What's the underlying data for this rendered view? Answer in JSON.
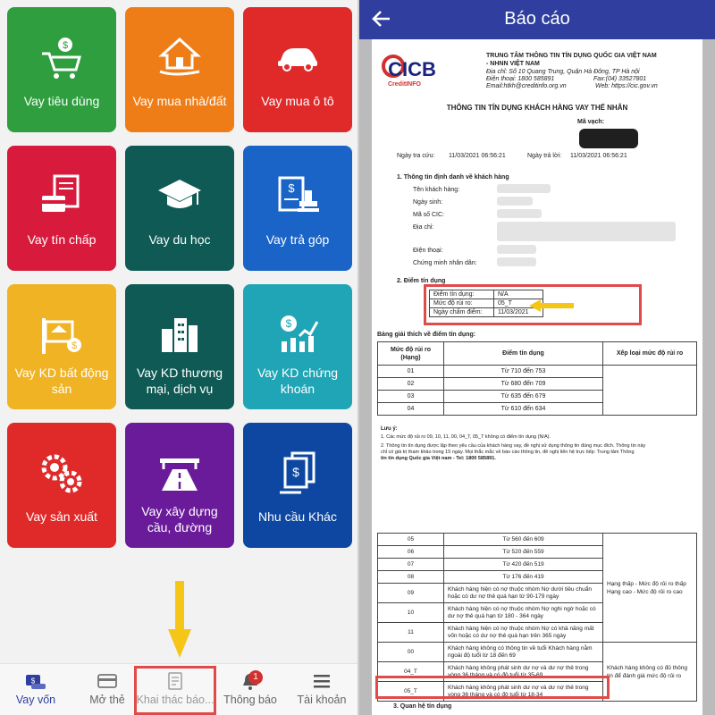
{
  "left": {
    "tiles": [
      {
        "label": "Vay tiêu dùng",
        "color": "#2e9e3e",
        "icon": "shopping-cart-icon"
      },
      {
        "label": "Vay mua nhà/đất",
        "color": "#ef7d17",
        "icon": "house-hand-icon"
      },
      {
        "label": "Vay mua ô tô",
        "color": "#e02a2a",
        "icon": "car-icon"
      },
      {
        "label": "Vay tín chấp",
        "color": "#d81b3c",
        "icon": "documents-card-icon"
      },
      {
        "label": "Vay du học",
        "color": "#0f5a55",
        "icon": "graduation-cap-icon"
      },
      {
        "label": "Vay trả góp",
        "color": "#1a63c7",
        "icon": "contract-stamp-icon"
      },
      {
        "label": "Vay KD bất động sản",
        "color": "#f0b324",
        "icon": "real-estate-sign-icon"
      },
      {
        "label": "Vay KD thương mại, dịch vụ",
        "color": "#0f5a55",
        "icon": "city-buildings-icon"
      },
      {
        "label": "Vay KD chứng khoán",
        "color": "#1fa5b5",
        "icon": "stock-chart-icon"
      },
      {
        "label": "Vay sản xuất",
        "color": "#e02a2a",
        "icon": "gears-icon"
      },
      {
        "label": "Vay xây dựng cầu, đường",
        "color": "#6a1b9a",
        "icon": "road-bridge-icon"
      },
      {
        "label": "Nhu cầu Khác",
        "color": "#0d47a1",
        "icon": "money-papers-icon"
      }
    ],
    "bottom_nav": [
      {
        "label": "Vay vốn",
        "icon": "loan-icon",
        "active": true
      },
      {
        "label": "Mở thẻ",
        "icon": "credit-card-icon",
        "active": false
      },
      {
        "label": "Khai thác báo...",
        "icon": "report-icon",
        "active": false
      },
      {
        "label": "Thông báo",
        "icon": "bell-icon",
        "active": false
      },
      {
        "label": "Tài khoản",
        "icon": "menu-icon",
        "active": false
      }
    ],
    "notification_badge": "1",
    "colors": {
      "active_nav": "#303f9f",
      "highlight": "#e14a4a",
      "arrow": "#f5c518"
    }
  },
  "right": {
    "title": "Báo cáo",
    "report": {
      "logo_text": "CICB",
      "logo_sub": "CreditINFO",
      "org_line1": "TRUNG TÂM THÔNG TIN TÍN DỤNG QUỐC GIA VIỆT NAM",
      "org_line2": "- NHNN VIỆT NAM",
      "address": "Địa chỉ: Số 10 Quang Trung, Quận Hà Đông, TP Hà nội",
      "phone": "Điện thoại: 1800 585891",
      "fax": "Fax:(04) 33527801",
      "email": "Email:htkh@creditinfo.org.vn",
      "web": "Web: https://cic.gov.vn",
      "main_title": "THÔNG TIN TÍN DỤNG KHÁCH HÀNG VAY THỂ NHÂN",
      "barcode_label": "Mã vạch:",
      "query_date_label": "Ngày tra cứu:",
      "query_date": "11/03/2021 06:56:21",
      "reply_date_label": "Ngày trả lời:",
      "reply_date": "11/03/2021 06:56:21",
      "section1": "1. Thông tin định danh về khách hàng",
      "fields": [
        "Tên khách hàng:",
        "Ngày sinh:",
        "Mã số CIC:",
        "Địa chỉ:",
        "Điện thoại:",
        "Chứng minh nhân dân:"
      ],
      "section2": "2. Điểm tín dụng",
      "score_rows": [
        {
          "label": "Điểm tín dụng:",
          "value": "N/A"
        },
        {
          "label": "Mức độ rủi ro:",
          "value": "05_T"
        },
        {
          "label": "Ngày chấm điểm:",
          "value": "11/03/2021"
        }
      ],
      "table_title": "Bảng giải thích về điểm tín dụng:",
      "headers": [
        "Mức độ rủi ro (Hạng)",
        "Điểm tín dụng",
        "Xếp loại mức độ rủi ro"
      ],
      "table1": [
        {
          "rank": "01",
          "score": "Từ 710 đến 753"
        },
        {
          "rank": "02",
          "score": "Từ 680 đến 709"
        },
        {
          "rank": "03",
          "score": "Từ 635 đến 679"
        },
        {
          "rank": "04",
          "score": "Từ 610 đến 634"
        }
      ],
      "notes_title": "Lưu ý:",
      "note1": "1. Các mức độ rủi ro 09, 10, 11, 00, 04_T, 05_T không có điểm tín dụng (N/A).",
      "note2a": "2. Thông tin tín dụng được lập theo yêu cầu của khách hàng vay, đề nghị sử dụng thông tin đúng mục đích. Thông tin này",
      "note2b": "chỉ có giá trị tham khảo trong 15 ngày. Mọi thắc mắc về báo cáo thông tin, đề nghị liên hệ trực tiếp: Trung tâm Thông",
      "note2c": "tin tín dụng Quốc gia Việt nam - Tel: 1800 585891.",
      "table2": [
        {
          "rank": "05",
          "score": "Từ 560 đến 609"
        },
        {
          "rank": "06",
          "score": "Từ 520 đến 559"
        },
        {
          "rank": "07",
          "score": "Từ 420 đến 519"
        },
        {
          "rank": "08",
          "score": "Từ 176 đến 419"
        },
        {
          "rank": "09",
          "score": "Khách hàng hiện có nợ thuộc nhóm Nợ dưới tiêu chuẩn hoặc có dư nợ thẻ quá hạn từ 90-179 ngày"
        },
        {
          "rank": "10",
          "score": "Khách hàng hiện có nợ thuộc nhóm Nợ nghi ngờ hoặc có dư nợ thẻ quá hạn từ 180 - 364 ngày"
        },
        {
          "rank": "11",
          "score": "Khách hàng hiện có nợ thuộc nhóm Nợ có khả năng mất vốn hoặc có dư nợ thẻ quá hạn trên 365 ngày"
        },
        {
          "rank": "00",
          "score": "Khách hàng không có thông tin về tuổi Khách hàng nằm ngoài độ tuổi từ 18 đến 69"
        },
        {
          "rank": "04_T",
          "score": "Khách hàng không phát sinh dư nợ và dư nợ thẻ trong vòng 36 tháng và có độ tuổi từ 35-69"
        },
        {
          "rank": "05_T",
          "score": "Khách hàng không phát sinh dư nợ và dư nợ thẻ trong vòng 36 tháng và có độ tuổi từ 18-34"
        }
      ],
      "class_low_high": "Hạng thấp - Mức độ rủi ro thấp Hạng cao - Mức độ rủi ro cao",
      "class_no_info": "Khách hàng không có đủ thông tin để đánh giá mức độ rủi ro",
      "section3": "3. Quan hệ tín dụng"
    }
  }
}
